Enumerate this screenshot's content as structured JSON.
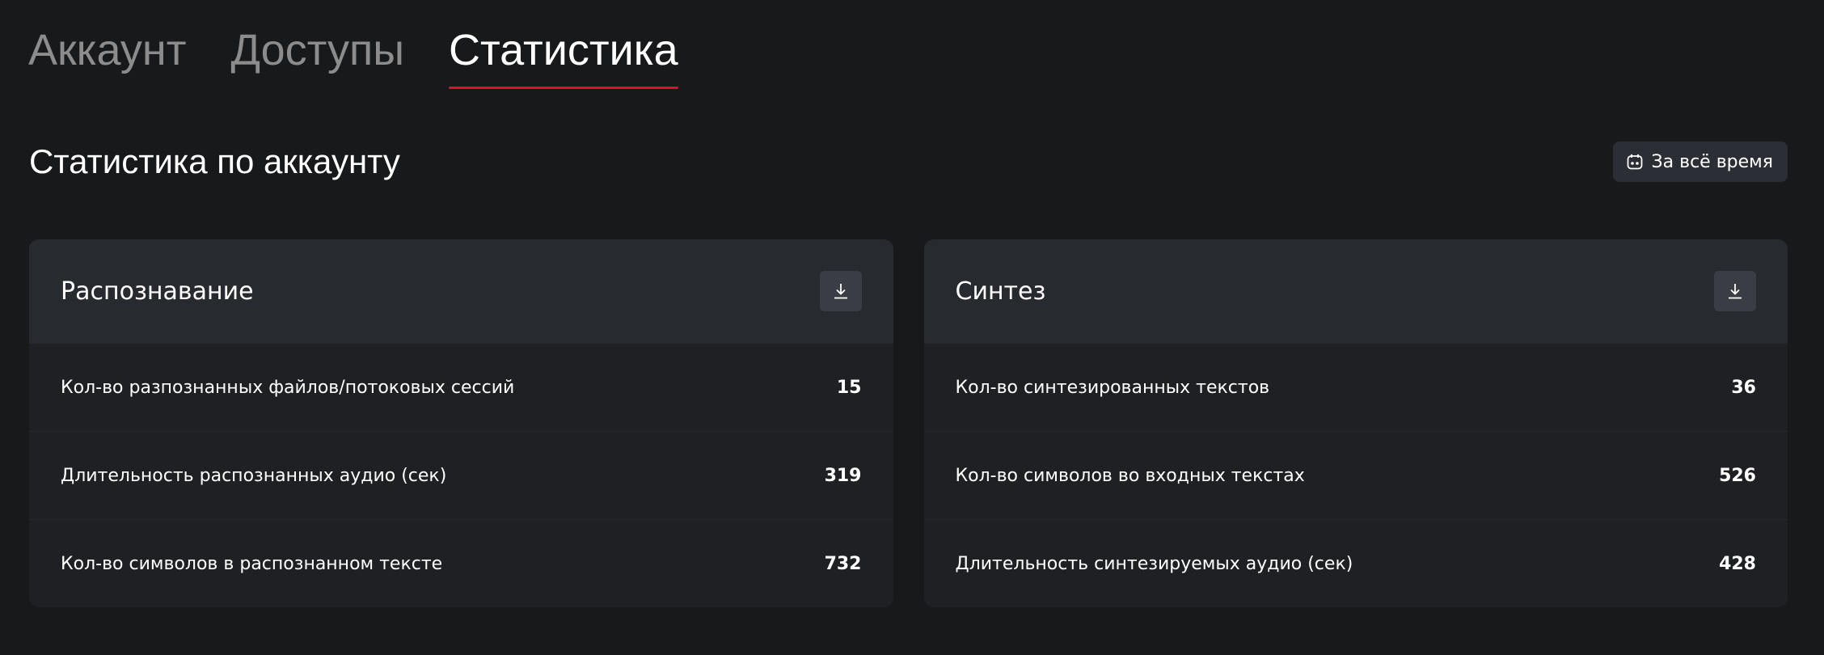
{
  "tabs": [
    {
      "label": "Аккаунт",
      "active": false
    },
    {
      "label": "Доступы",
      "active": false
    },
    {
      "label": "Статистика",
      "active": true
    }
  ],
  "section": {
    "title": "Статистика по аккаунту",
    "period_button": {
      "label": "За всё время",
      "icon": "calendar-icon"
    }
  },
  "colors": {
    "background": "#18191b",
    "accent": "#d9112f",
    "card": "#1e2023",
    "card_header": "#272a2f"
  },
  "cards": [
    {
      "title": "Распознавание",
      "download_icon": "download-icon",
      "rows": [
        {
          "label": "Кол-во разпознанных файлов/потоковых сессий",
          "value": "15"
        },
        {
          "label": "Длительность распознанных аудио (сек)",
          "value": "319"
        },
        {
          "label": "Кол-во символов в распознанном тексте",
          "value": "732"
        }
      ]
    },
    {
      "title": "Синтез",
      "download_icon": "download-icon",
      "rows": [
        {
          "label": "Кол-во синтезированных текстов",
          "value": "36"
        },
        {
          "label": "Кол-во символов во входных текстах",
          "value": "526"
        },
        {
          "label": "Длительность синтезируемых аудио (сек)",
          "value": "428"
        }
      ]
    }
  ]
}
